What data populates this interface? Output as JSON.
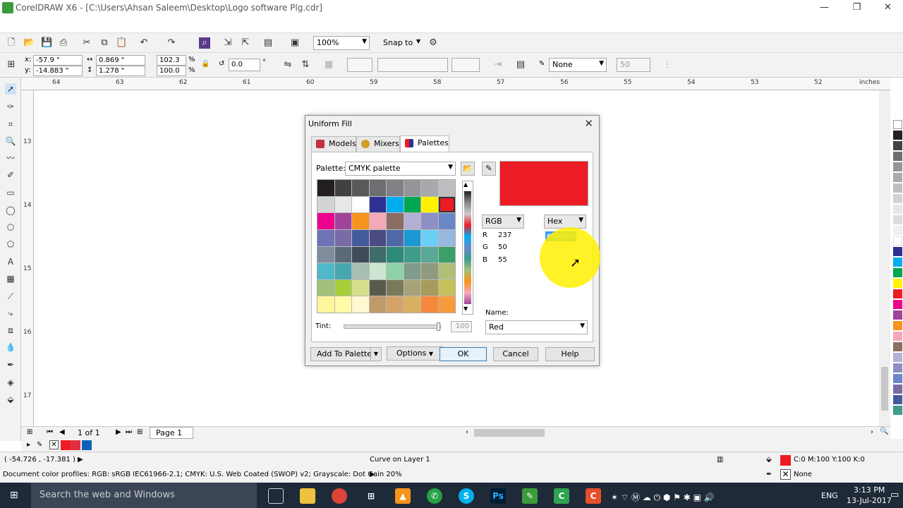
{
  "window": {
    "title": "CorelDRAW X6 - [C:\\Users\\Ahsan Saleem\\Desktop\\Logo software Plg.cdr]",
    "minimize": "—",
    "maximize": "❐",
    "close": "✕"
  },
  "toolbar": {
    "zoom": "100%",
    "snap_to": "Snap to"
  },
  "property_bar": {
    "x_label": "x:",
    "x_value": "-57.9 \"",
    "y_label": "y:",
    "y_value": "-14.883 \"",
    "width_value": "0.869 \"",
    "height_value": "1.278 \"",
    "scale_w": "102.3",
    "scale_h": "100.0",
    "percent": "%",
    "rotation": "0.0",
    "degree": "°",
    "outline": "None",
    "value_50": "50"
  },
  "ruler": {
    "h_ticks": [
      "64",
      "63",
      "62",
      "61",
      "60",
      "59",
      "58",
      "57",
      "56",
      "55",
      "54",
      "53",
      "52"
    ],
    "unit": "inches",
    "v_ticks": [
      "13",
      "14",
      "15",
      "16",
      "17"
    ]
  },
  "page_nav": {
    "page_count": "1 of 1",
    "page_tab": "Page 1"
  },
  "status": {
    "coords": "( -54.726 , -17.381 )",
    "curve_info": "Curve on Layer 1",
    "fill_info": "C:0 M:100 Y:100 K:0",
    "outline_info": "None",
    "color_profiles": "Document color profiles: RGB: sRGB IEC61966-2.1; CMYK: U.S. Web Coated (SWOP) v2; Grayscale: Dot Gain 20%"
  },
  "dialog": {
    "title": "Uniform Fill",
    "tabs": [
      {
        "label": "Models"
      },
      {
        "label": "Mixers"
      },
      {
        "label": "Palettes"
      }
    ],
    "palette_label": "Palette:",
    "palette_value": "CMYK palette",
    "color_model": "RGB",
    "value_format": "Hex",
    "r_label": "R",
    "r_value": "237",
    "g_label": "G",
    "g_value": "50",
    "b_label": "B",
    "b_value": "55",
    "hex_value": "#ED3237",
    "name_label": "Name:",
    "name_value": "Red",
    "tint_label": "Tint:",
    "tint_value": "100",
    "tint_level": 1.0,
    "buttons": {
      "add_to_palette": "Add To Palette",
      "options": "Options",
      "ok": "OK",
      "cancel": "Cancel",
      "help": "Help"
    },
    "preview_color": "#ED1C24",
    "swatches": [
      "#231f20",
      "#414042",
      "#58595b",
      "#6d6e71",
      "#808285",
      "#939598",
      "#a7a9ac",
      "#bcbec0",
      "#d1d3d4",
      "#e6e7e8",
      "#ffffff",
      "#2e3192",
      "#00aeef",
      "#00a651",
      "#fff200",
      "#ed1c24",
      "#ec008c",
      "#a0449a",
      "#f7941d",
      "#f5a9b8",
      "#8b6d63",
      "#b3b0d6",
      "#8e8fc4",
      "#6a87c7",
      "#6d73b4",
      "#7a6aa6",
      "#435a9c",
      "#4d4b83",
      "#4d6aa6",
      "#1b97d4",
      "#6dcff6",
      "#97b8de",
      "#7e8c9c",
      "#5a6b78",
      "#3f4b56",
      "#3e6b6b",
      "#2e8a78",
      "#3f9b8a",
      "#5aa896",
      "#3aa06a",
      "#50b8c8",
      "#48a6ae",
      "#a7bfb0",
      "#cde6d2",
      "#8fd1a8",
      "#7f9c8c",
      "#909a7e",
      "#b0bf78",
      "#9fc07a",
      "#a6ce39",
      "#d6e08a",
      "#5a5a4a",
      "#7a7a5a",
      "#a8a278",
      "#a89a5a",
      "#c8c058",
      "#fff59a",
      "#fffaa8",
      "#fff8d0",
      "#c09a6a",
      "#d4a36a",
      "#d9b060",
      "#f7883a",
      "#f79a3a"
    ]
  },
  "taskbar": {
    "search": "Search the web and Windows",
    "time": "3:13 PM",
    "date": "13-Jul-2017",
    "lang": "ENG"
  },
  "colors": {
    "app_green": "#3a9b3a",
    "accent_red": "#ED1C24",
    "taskbar_bg": "#1f2a38"
  }
}
